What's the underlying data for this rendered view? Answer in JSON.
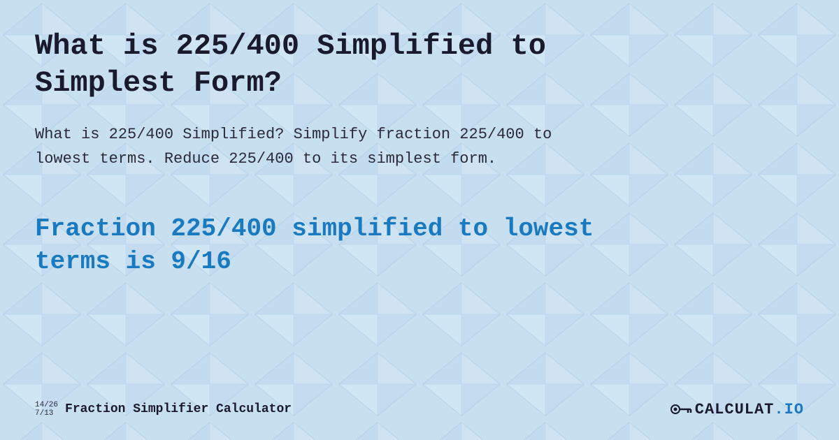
{
  "background": {
    "color": "#d6e8f7"
  },
  "title": "What is 225/400 Simplified to Simplest Form?",
  "description": "What is 225/400 Simplified? Simplify fraction 225/400 to lowest terms. Reduce 225/400 to its simplest form.",
  "result": "Fraction 225/400 simplified to lowest terms is 9/16",
  "footer": {
    "fraction_top": "14/26",
    "fraction_bottom": "7/13",
    "brand_label": "Fraction Simplifier Calculator",
    "logo_text": "CALCULAT.IO"
  }
}
